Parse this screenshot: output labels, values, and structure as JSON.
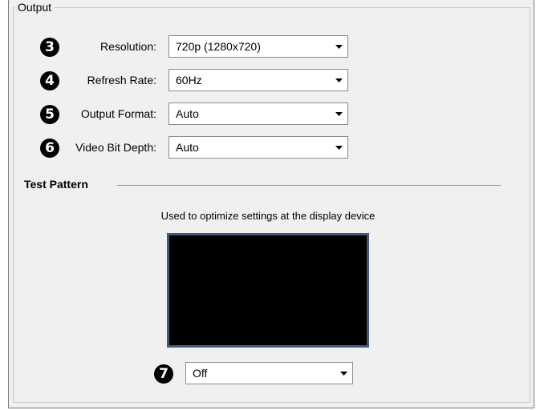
{
  "group": {
    "title": "Output"
  },
  "settings": [
    {
      "badge": "3",
      "label": "Resolution:",
      "value": "720p (1280x720)"
    },
    {
      "badge": "4",
      "label": "Refresh Rate:",
      "value": "60Hz"
    },
    {
      "badge": "5",
      "label": "Output Format:",
      "value": "Auto"
    },
    {
      "badge": "6",
      "label": "Video Bit Depth:",
      "value": "Auto"
    }
  ],
  "test_pattern": {
    "title": "Test Pattern",
    "hint": "Used to optimize settings at the display device",
    "badge": "7",
    "value": "Off"
  },
  "icons": {
    "dropdown_arrow": "chevron-down-icon"
  },
  "colors": {
    "panel_bg": "#f0f0f0",
    "preview_border": "#41597a",
    "preview_bg": "#000000"
  }
}
